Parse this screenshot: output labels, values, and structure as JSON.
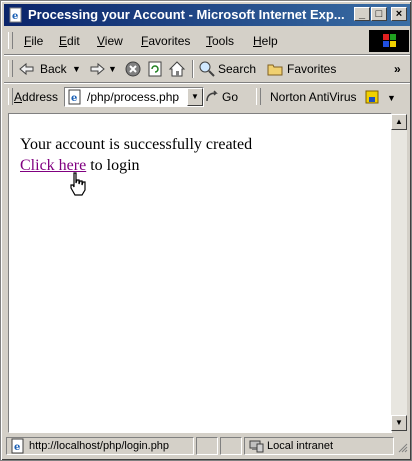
{
  "window": {
    "title": "Processing your Account - Microsoft Internet Exp...",
    "title_bar_color": "#0a246a"
  },
  "menu": {
    "items": [
      "File",
      "Edit",
      "View",
      "Favorites",
      "Tools",
      "Help"
    ]
  },
  "toolbar": {
    "back_label": "Back",
    "search_label": "Search",
    "favorites_label": "Favorites",
    "more": "»"
  },
  "address": {
    "label": "Address",
    "value": "/php/process.php",
    "go_label": "Go",
    "norton_label": "Norton AntiVirus"
  },
  "page": {
    "message": "Your account is successfully created",
    "link_text": "Click here",
    "link_suffix": " to login",
    "link_color": "#800080"
  },
  "status": {
    "url": "http://localhost/php/login.php",
    "zone": "Local intranet"
  }
}
